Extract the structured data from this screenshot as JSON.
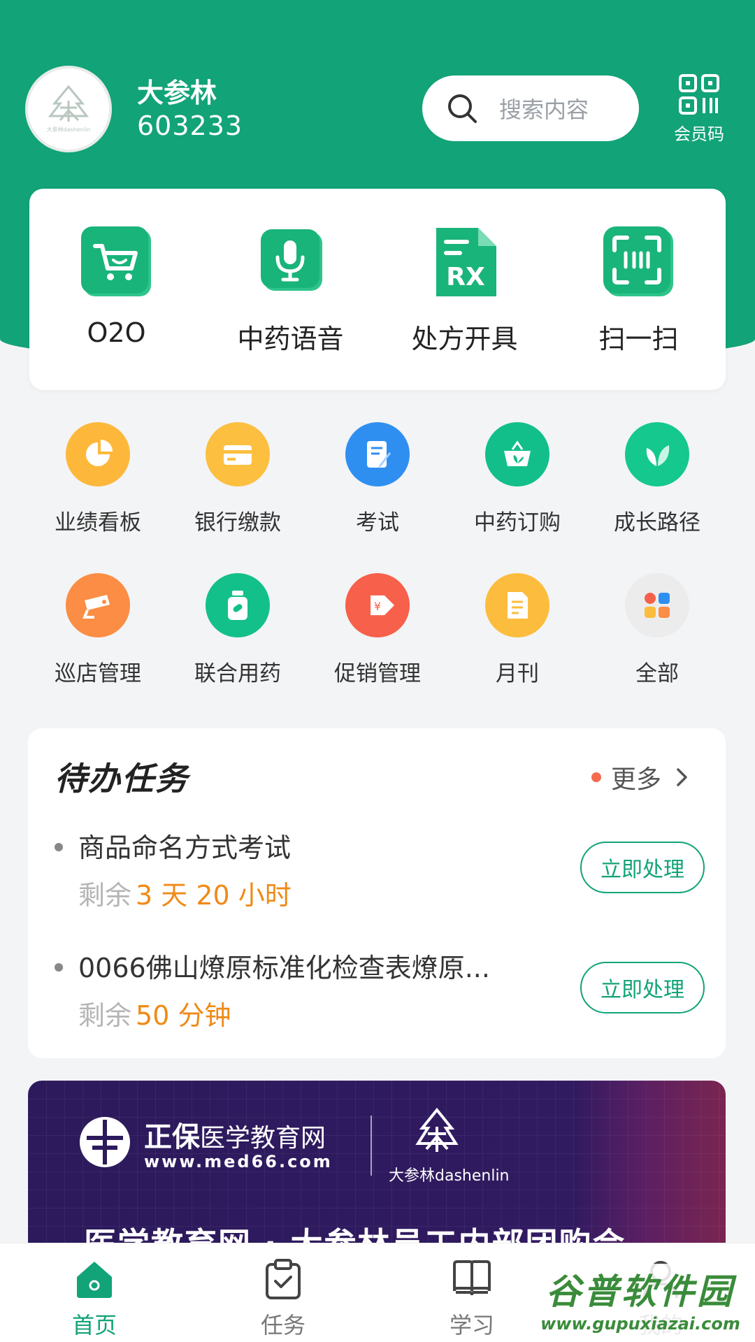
{
  "user": {
    "name": "大参林",
    "id": "603233",
    "avatar_text": "大参林dashenlin"
  },
  "search": {
    "placeholder": "搜索内容"
  },
  "member_code": {
    "label": "会员码"
  },
  "top_actions": [
    {
      "label": "O2O",
      "icon": "shopping-cart-icon"
    },
    {
      "label": "中药语音",
      "icon": "microphone-icon"
    },
    {
      "label": "处方开具",
      "icon": "prescription-rx-icon"
    },
    {
      "label": "扫一扫",
      "icon": "scan-icon"
    }
  ],
  "grid": [
    {
      "label": "业绩看板",
      "icon": "pie-chart-icon"
    },
    {
      "label": "银行缴款",
      "icon": "bank-card-icon"
    },
    {
      "label": "考试",
      "icon": "exam-edit-icon"
    },
    {
      "label": "中药订购",
      "icon": "herb-basket-icon"
    },
    {
      "label": "成长路径",
      "icon": "leaf-icon"
    },
    {
      "label": "巡店管理",
      "icon": "camera-patrol-icon"
    },
    {
      "label": "联合用药",
      "icon": "medicine-bottle-icon"
    },
    {
      "label": "促销管理",
      "icon": "price-tag-icon"
    },
    {
      "label": "月刊",
      "icon": "document-icon"
    },
    {
      "label": "全部",
      "icon": "all-apps-icon"
    }
  ],
  "todo": {
    "title": "待办任务",
    "more_label": "更多",
    "remain_prefix": "剩余",
    "action_label": "立即处理",
    "tasks": [
      {
        "name": "商品命名方式考试",
        "remain": "3 天 20 小时"
      },
      {
        "name": "0066佛山燎原标准化检查表燎原...",
        "remain": "50 分钟"
      }
    ]
  },
  "banner": {
    "brand": "正保",
    "brand_sub": "医学教育网",
    "url": "www.med66.com",
    "partner": "大参林dashenlin",
    "headline": "医学教育网 · 大参林员工内部团购会"
  },
  "tabs": [
    {
      "label": "首页",
      "icon": "home-icon",
      "active": true
    },
    {
      "label": "任务",
      "icon": "task-clipboard-icon",
      "active": false
    },
    {
      "label": "学习",
      "icon": "book-icon",
      "active": false
    },
    {
      "label": "我的",
      "icon": "profile-icon",
      "active": false
    }
  ],
  "watermark": {
    "title": "谷普软件园",
    "url": "www.gupuxiazai.com"
  },
  "colors": {
    "primary": "#12a378",
    "accent_orange": "#f08a18",
    "dot_red": "#f46a4e"
  }
}
